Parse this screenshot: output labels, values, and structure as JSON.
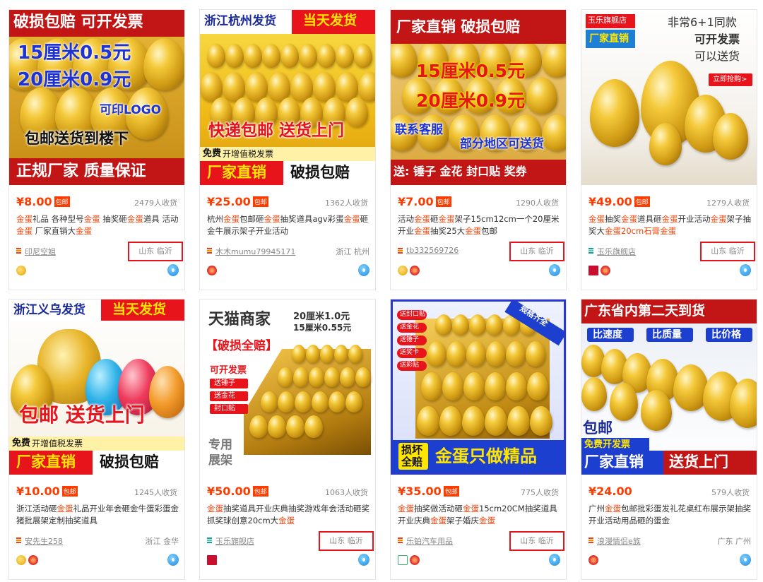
{
  "products": [
    {
      "banner": [
        "破损包赔 可开发票",
        "15厘米0.5元",
        "20厘米0.9元",
        "可印LOGO",
        "包邮送货到楼下",
        "正规厂家 质量保证"
      ],
      "price": "¥8.00",
      "baoyou": "包邮",
      "sales": "2479人收货",
      "title_parts": [
        "金蛋",
        "礼品 各种型号",
        "金蛋",
        " 抽奖砸",
        "金蛋",
        "道具 活动",
        "金蛋",
        " 厂家直销大",
        "金蛋"
      ],
      "shop": "印尼空姐",
      "location": "山东 临沂",
      "location_highlight": true
    },
    {
      "banner": [
        "浙江杭州发货",
        "当天发货",
        "快递包邮 送货上门",
        "免费",
        "开增值税发票",
        "厂家直销",
        "破损包赔"
      ],
      "price": "¥25.00",
      "baoyou": "包邮",
      "sales": "1362人收货",
      "title_parts": [
        "杭州",
        "金蛋",
        "包邮砸",
        "金蛋",
        "抽奖道具agv彩蛋",
        "金蛋",
        "",
        "",
        "砸金牛展示架子开业活动"
      ],
      "shop": "木木mumu79945171",
      "location": "浙江 杭州",
      "location_highlight": false
    },
    {
      "banner": [
        "厂家直销 破损包赔",
        "15厘米0.5元",
        "20厘米0.9元",
        "联系客服",
        "部分地区可送货",
        "送: 锤子 金花 封口贴 奖券"
      ],
      "price": "¥7.00",
      "baoyou": "包邮",
      "sales": "1290人收货",
      "title_parts": [
        "活动",
        "金蛋",
        "砸",
        "金蛋",
        "架子15cm12cm一个20厘米开业",
        "金蛋",
        "抽奖25大",
        "金蛋",
        "包邮"
      ],
      "shop": "tb332569726",
      "location": "山东 临沂",
      "location_highlight": true
    },
    {
      "banner": [
        "玉乐旗舰店",
        "厂家直销",
        "非常6+1同款",
        "可开发票",
        "可以送货",
        "立即抢购>"
      ],
      "price": "¥49.00",
      "baoyou": "包邮",
      "sales": "1279人收货",
      "title_parts": [
        "金蛋",
        "抽奖",
        "金蛋",
        "道具砸",
        "金蛋",
        "开业活动",
        "金蛋",
        "架子抽奖大",
        "金蛋20cm石膏金蛋"
      ],
      "shop": "玉乐旗舰店",
      "location": "山东 临沂",
      "location_highlight": true
    },
    {
      "banner": [
        "浙江义乌发货",
        "当天发货",
        "包邮 送货上门",
        "免费",
        "开增值税发票",
        "厂家直销",
        "破损包赔"
      ],
      "price": "¥10.00",
      "baoyou": "包邮",
      "sales": "1245人收货",
      "title_parts": [
        "浙江活动砸",
        "金蛋",
        "礼品开业年会砸金牛蛋彩蛋金猪批展架定制抽奖道具",
        "",
        "",
        "",
        "",
        "",
        ""
      ],
      "shop": "安先生258",
      "location": "浙江 金华",
      "location_highlight": false
    },
    {
      "banner": [
        "天猫商家",
        "20厘米1.0元",
        "15厘米0.55元",
        "【破损全赔】",
        "可开发票",
        "送锤子",
        "送金花",
        "封口贴",
        "专用",
        "展架"
      ],
      "price": "¥50.00",
      "baoyou": "包邮",
      "sales": "1063人收货",
      "title_parts": [
        "金蛋",
        "抽奖道具开业庆典抽奖游戏年会活动砸奖抓奖球创意20cm大",
        "金蛋",
        "",
        "",
        "",
        "",
        "",
        ""
      ],
      "shop": "玉乐旗舰店",
      "location": "山东 临沂",
      "location_highlight": true
    },
    {
      "banner": [
        "规格齐全",
        "送封口贴",
        "送金花",
        "送锤子",
        "送奖卡",
        "送彩贴",
        "损坏",
        "全赔",
        "金蛋只做精品"
      ],
      "price": "¥35.00",
      "baoyou": "包邮",
      "sales": "775人收货",
      "title_parts": [
        "金蛋",
        "抽奖做活动砸",
        "金蛋",
        "15cm20CM抽奖道具开业庆典",
        "金蛋",
        "架子婚庆",
        "金蛋",
        "",
        ""
      ],
      "shop": "乐铂汽车用品",
      "location": "山东 临沂",
      "location_highlight": true
    },
    {
      "banner": [
        "广东省内第二天到货",
        "比速度",
        "比质量",
        "比价格",
        "包邮",
        "免费开发票",
        "厂家直销",
        "送货上门"
      ],
      "price": "¥24.00",
      "baoyou": "",
      "sales": "579人收货",
      "title_parts": [
        "广州",
        "金蛋",
        "包邮批彩蛋发礼花桌红布展示架抽奖开业活动用品砸的蛋金",
        "",
        "",
        "",
        "",
        "",
        ""
      ],
      "shop": "浪漫情侣e族",
      "location": "广东 广州",
      "location_highlight": false
    }
  ],
  "icons": {
    "wangwang": "wangwang-chat-icon",
    "shop": "shop-stripe-icon"
  },
  "colors": {
    "price": "#ff3c00",
    "highlight_box": "#e8141b",
    "keyword": "#ff3c00"
  }
}
